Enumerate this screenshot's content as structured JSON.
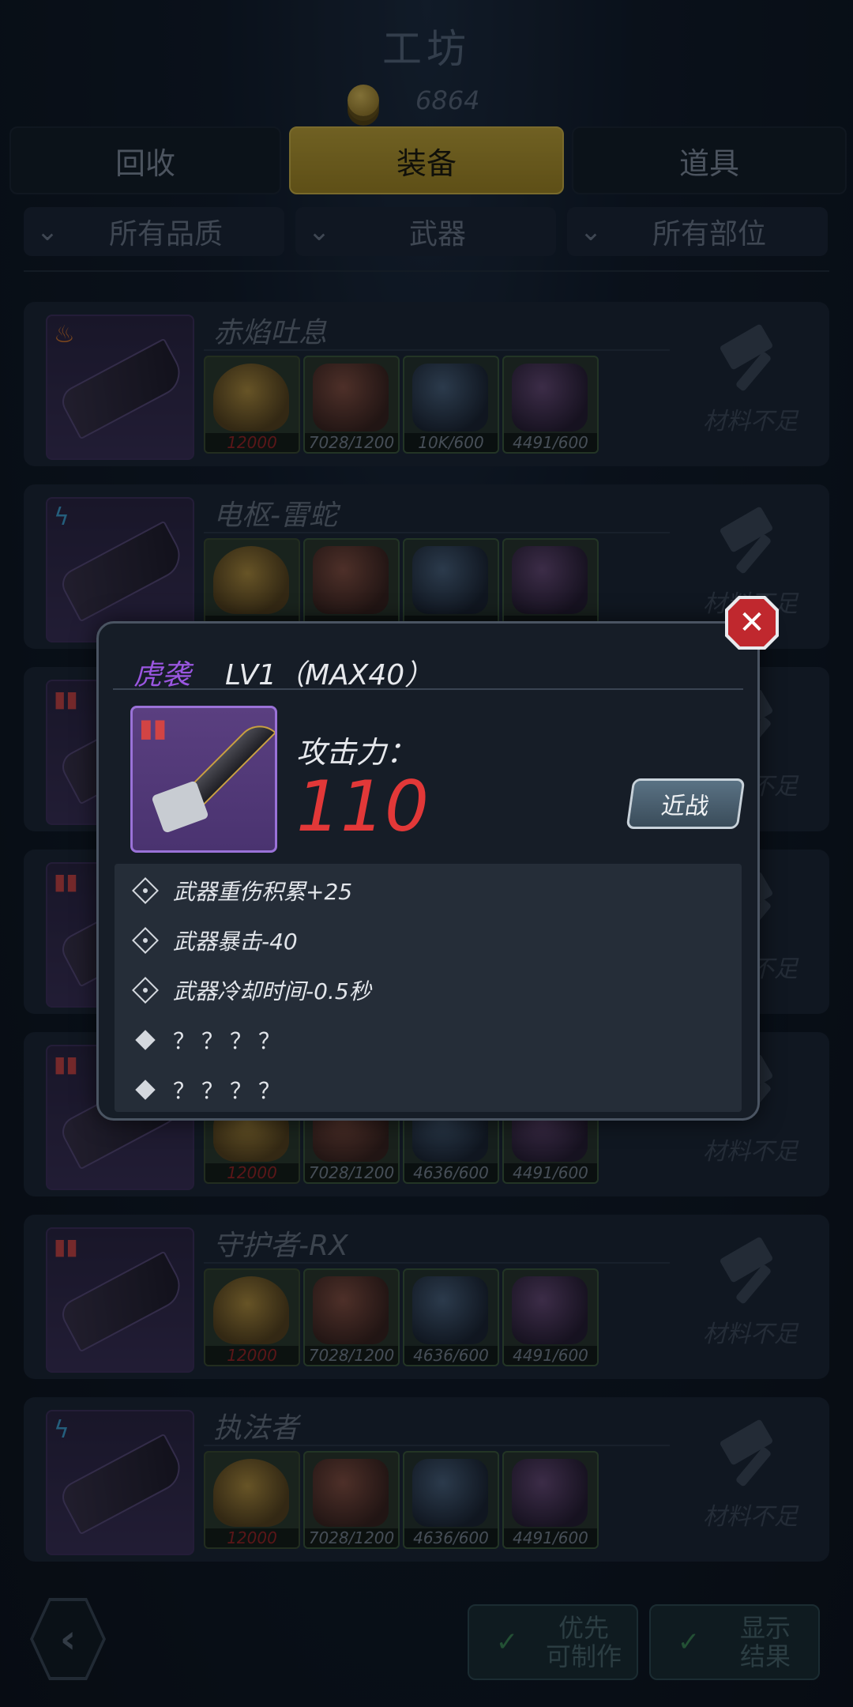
{
  "header": {
    "title": "工坊",
    "coins": "6864"
  },
  "tabs": [
    {
      "label": "回收",
      "active": false
    },
    {
      "label": "装备",
      "active": true
    },
    {
      "label": "道具",
      "active": false
    }
  ],
  "filters": [
    {
      "label": "所有品质"
    },
    {
      "label": "武器"
    },
    {
      "label": "所有部位"
    }
  ],
  "list": {
    "craft_label": "材料不足",
    "items": [
      {
        "name": "赤焰吐息",
        "element": "fire",
        "mats": [
          "12000",
          "7028/1200",
          "10K/600",
          "4491/600"
        ]
      },
      {
        "name": "电枢-雷蛇",
        "element": "bolt",
        "mats": [
          "",
          "",
          "",
          ""
        ]
      },
      {
        "name": "",
        "element": "ammo",
        "mats": [
          "",
          "",
          "",
          ""
        ]
      },
      {
        "name": "",
        "element": "ammo",
        "mats": [
          "",
          "",
          "",
          ""
        ]
      },
      {
        "name": "",
        "element": "ammo",
        "mats": [
          "12000",
          "7028/1200",
          "4636/600",
          "4491/600"
        ]
      },
      {
        "name": "守护者-RX",
        "element": "ammo",
        "mats": [
          "12000",
          "7028/1200",
          "4636/600",
          "4491/600"
        ]
      },
      {
        "name": "执法者",
        "element": "bolt",
        "mats": [
          "12000",
          "7028/1200",
          "4636/600",
          "4491/600"
        ]
      }
    ]
  },
  "modal": {
    "name": "虎袭",
    "level": "LV1（MAX40）",
    "attack_label": "攻击力：",
    "attack_value": "110",
    "type_button": "近战",
    "attributes": [
      {
        "text": "武器重伤积累+25",
        "icon": "lock-icon"
      },
      {
        "text": "武器暴击-40",
        "icon": "lock-icon"
      },
      {
        "text": "武器冷却时间-0.5秒",
        "icon": "lock-icon"
      },
      {
        "text": "？？？？",
        "icon": "diamond-icon"
      },
      {
        "text": "？？？？",
        "icon": "diamond-icon"
      }
    ]
  },
  "bottom": {
    "priority_label": "优先\n可制作",
    "show_label": "显示\n结果"
  }
}
